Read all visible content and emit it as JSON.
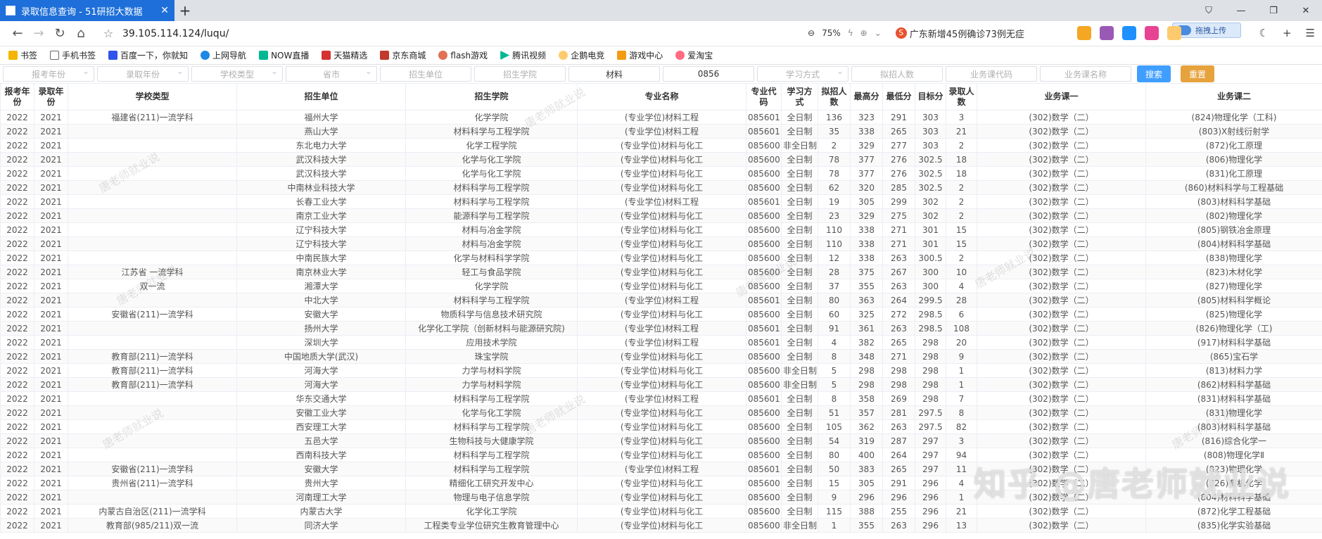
{
  "browser": {
    "tab_title": "录取信息查询 - 51研招大数据",
    "url": "39.105.114.124/luqu/",
    "zoom": "75%",
    "news_text": "广东新增45例确诊73例无症",
    "upload_label": "拖拽上传"
  },
  "bookmarks": [
    "书签",
    "手机书签",
    "百度一下，你就知",
    "上网导航",
    "NOW直播",
    "天猫精选",
    "京东商城",
    "flash游戏",
    "腾讯视频",
    "企鹅电竞",
    "游戏中心",
    "爱淘宝"
  ],
  "filters": {
    "report_year": "报考年份",
    "admit_year": "录取年份",
    "school_type": "学校类型",
    "province": "省市",
    "unit": "招生单位",
    "college": "招生学院",
    "major": "材料",
    "major_code": "0856",
    "study_mode": "学习方式",
    "plan_count": "拟招人数",
    "course_code": "业务课代码",
    "course_name": "业务课名称",
    "search": "搜索",
    "reset": "重置"
  },
  "table": {
    "headers": [
      "报考年份",
      "录取年份",
      "学校类型",
      "招生单位",
      "招生学院",
      "专业名称",
      "专业代码",
      "学习方式",
      "拟招人数",
      "最高分",
      "最低分",
      "目标分",
      "录取人数",
      "业务课一",
      "业务课二"
    ],
    "rows": [
      [
        "2022",
        "2021",
        "福建省(211)一流学科",
        "福州大学",
        "化学学院",
        "(专业学位)材料工程",
        "085601",
        "全日制",
        "136",
        "323",
        "291",
        "303",
        "3",
        "(302)数学（二）",
        "(824)物理化学（工科)"
      ],
      [
        "2022",
        "2021",
        "",
        "燕山大学",
        "材料科学与工程学院",
        "(专业学位)材料工程",
        "085601",
        "全日制",
        "35",
        "338",
        "265",
        "303",
        "21",
        "(302)数学（二）",
        "(803)X射线衍射学"
      ],
      [
        "2022",
        "2021",
        "",
        "东北电力大学",
        "化学工程学院",
        "(专业学位)材料与化工",
        "085600",
        "非全日制",
        "2",
        "329",
        "277",
        "303",
        "2",
        "(302)数学（二）",
        "(872)化工原理"
      ],
      [
        "2022",
        "2021",
        "",
        "武汉科技大学",
        "化学与化工学院",
        "(专业学位)材料与化工",
        "085600",
        "全日制",
        "78",
        "377",
        "276",
        "302.5",
        "18",
        "(302)数学（二）",
        "(806)物理化学"
      ],
      [
        "2022",
        "2021",
        "",
        "武汉科技大学",
        "化学与化工学院",
        "(专业学位)材料与化工",
        "085600",
        "全日制",
        "78",
        "377",
        "276",
        "302.5",
        "18",
        "(302)数学（二）",
        "(831)化工原理"
      ],
      [
        "2022",
        "2021",
        "",
        "中南林业科技大学",
        "材料科学与工程学院",
        "(专业学位)材料与化工",
        "085600",
        "全日制",
        "62",
        "320",
        "285",
        "302.5",
        "2",
        "(302)数学（二）",
        "(860)材料科学与工程基础"
      ],
      [
        "2022",
        "2021",
        "",
        "长春工业大学",
        "材料科学与工程学院",
        "(专业学位)材料工程",
        "085601",
        "全日制",
        "19",
        "305",
        "299",
        "302",
        "2",
        "(302)数学（二）",
        "(803)材料科学基础"
      ],
      [
        "2022",
        "2021",
        "",
        "南京工业大学",
        "能源科学与工程学院",
        "(专业学位)材料与化工",
        "085600",
        "全日制",
        "23",
        "329",
        "275",
        "302",
        "2",
        "(302)数学（二）",
        "(802)物理化学"
      ],
      [
        "2022",
        "2021",
        "",
        "辽宁科技大学",
        "材料与冶金学院",
        "(专业学位)材料与化工",
        "085600",
        "全日制",
        "110",
        "338",
        "271",
        "301",
        "15",
        "(302)数学（二）",
        "(805)钢铁冶金原理"
      ],
      [
        "2022",
        "2021",
        "",
        "辽宁科技大学",
        "材料与冶金学院",
        "(专业学位)材料与化工",
        "085600",
        "全日制",
        "110",
        "338",
        "271",
        "301",
        "15",
        "(302)数学（二）",
        "(804)材料科学基础"
      ],
      [
        "2022",
        "2021",
        "",
        "中南民族大学",
        "化学与材料科学学院",
        "(专业学位)材料与化工",
        "085600",
        "全日制",
        "12",
        "338",
        "263",
        "300.5",
        "2",
        "(302)数学（二）",
        "(838)物理化学"
      ],
      [
        "2022",
        "2021",
        "江苏省 一流学科",
        "南京林业大学",
        "轻工与食品学院",
        "(专业学位)材料与化工",
        "085600",
        "全日制",
        "28",
        "375",
        "267",
        "300",
        "10",
        "(302)数学（二）",
        "(823)木材化学"
      ],
      [
        "2022",
        "2021",
        "双一流",
        "湘潭大学",
        "化学学院",
        "(专业学位)材料与化工",
        "085600",
        "全日制",
        "37",
        "355",
        "263",
        "300",
        "4",
        "(302)数学（二）",
        "(827)物理化学"
      ],
      [
        "2022",
        "2021",
        "",
        "中北大学",
        "材料科学与工程学院",
        "(专业学位)材料工程",
        "085601",
        "全日制",
        "80",
        "363",
        "264",
        "299.5",
        "28",
        "(302)数学（二）",
        "(805)材料科学概论"
      ],
      [
        "2022",
        "2021",
        "安徽省(211)一流学科",
        "安徽大学",
        "物质科学与信息技术研究院",
        "(专业学位)材料与化工",
        "085600",
        "全日制",
        "60",
        "325",
        "272",
        "298.5",
        "6",
        "(302)数学（二）",
        "(825)物理化学"
      ],
      [
        "2022",
        "2021",
        "",
        "扬州大学",
        "化学化工学院（创新材料与能源研究院)",
        "(专业学位)材料工程",
        "085601",
        "全日制",
        "91",
        "361",
        "263",
        "298.5",
        "108",
        "(302)数学（二）",
        "(826)物理化学（工)"
      ],
      [
        "2022",
        "2021",
        "",
        "深圳大学",
        "应用技术学院",
        "(专业学位)材料工程",
        "085601",
        "全日制",
        "4",
        "382",
        "265",
        "298",
        "20",
        "(302)数学（二）",
        "(917)材料科学基础"
      ],
      [
        "2022",
        "2021",
        "教育部(211)一流学科",
        "中国地质大学(武汉)",
        "珠宝学院",
        "(专业学位)材料与化工",
        "085600",
        "全日制",
        "8",
        "348",
        "271",
        "298",
        "9",
        "(302)数学（二）",
        "(865)宝石学"
      ],
      [
        "2022",
        "2021",
        "教育部(211)一流学科",
        "河海大学",
        "力学与材料学院",
        "(专业学位)材料与化工",
        "085600",
        "非全日制",
        "5",
        "298",
        "298",
        "298",
        "1",
        "(302)数学（二）",
        "(813)材料力学"
      ],
      [
        "2022",
        "2021",
        "教育部(211)一流学科",
        "河海大学",
        "力学与材料学院",
        "(专业学位)材料与化工",
        "085600",
        "非全日制",
        "5",
        "298",
        "298",
        "298",
        "1",
        "(302)数学（二）",
        "(862)材料科学基础"
      ],
      [
        "2022",
        "2021",
        "",
        "华东交通大学",
        "材料科学与工程学院",
        "(专业学位)材料工程",
        "085601",
        "全日制",
        "8",
        "358",
        "269",
        "298",
        "7",
        "(302)数学（二）",
        "(831)材料科学基础"
      ],
      [
        "2022",
        "2021",
        "",
        "安徽工业大学",
        "化学与化工学院",
        "(专业学位)材料与化工",
        "085600",
        "全日制",
        "51",
        "357",
        "281",
        "297.5",
        "8",
        "(302)数学（二）",
        "(831)物理化学"
      ],
      [
        "2022",
        "2021",
        "",
        "西安理工大学",
        "材料科学与工程学院",
        "(专业学位)材料与化工",
        "085600",
        "全日制",
        "105",
        "362",
        "263",
        "297.5",
        "82",
        "(302)数学（二）",
        "(803)材料科学基础"
      ],
      [
        "2022",
        "2021",
        "",
        "五邑大学",
        "生物科技与大健康学院",
        "(专业学位)材料与化工",
        "085600",
        "全日制",
        "54",
        "319",
        "287",
        "297",
        "3",
        "(302)数学（二）",
        "(816)综合化学一"
      ],
      [
        "2022",
        "2021",
        "",
        "西南科技大学",
        "材料科学与工程学院",
        "(专业学位)材料与化工",
        "085600",
        "全日制",
        "80",
        "400",
        "264",
        "297",
        "94",
        "(302)数学（二）",
        "(808)物理化学Ⅱ"
      ],
      [
        "2022",
        "2021",
        "安徽省(211)一流学科",
        "安徽大学",
        "材料科学与工程学院",
        "(专业学位)材料工程",
        "085601",
        "全日制",
        "50",
        "383",
        "265",
        "297",
        "11",
        "(302)数学（二）",
        "(823)物理化学"
      ],
      [
        "2022",
        "2021",
        "贵州省(211)一流学科",
        "贵州大学",
        "精细化工研究开发中心",
        "(专业学位)材料与化工",
        "085600",
        "全日制",
        "15",
        "305",
        "291",
        "296",
        "4",
        "(302)数学（二）",
        "(826)有机化学"
      ],
      [
        "2022",
        "2021",
        "",
        "河南理工大学",
        "物理与电子信息学院",
        "(专业学位)材料与化工",
        "085600",
        "全日制",
        "9",
        "296",
        "296",
        "296",
        "1",
        "(302)数学（二）",
        "(804)材料科学基础"
      ],
      [
        "2022",
        "2021",
        "内蒙古自治区(211)一流学科",
        "内蒙古大学",
        "化学化工学院",
        "(专业学位)材料与化工",
        "085600",
        "全日制",
        "115",
        "388",
        "255",
        "296",
        "21",
        "(302)数学（二）",
        "(872)化学工程基础"
      ],
      [
        "2022",
        "2021",
        "教育部(985/211)双一流",
        "同济大学",
        "工程类专业学位研究生教育管理中心",
        "(专业学位)材料与化工",
        "085600",
        "非全日制",
        "1",
        "355",
        "263",
        "296",
        "13",
        "(302)数学（二）",
        "(835)化学实验基础"
      ]
    ]
  },
  "watermarks": [
    "唐老师就业说",
    "唐老师就业说",
    "唐老师就业说",
    "唐老师就业说",
    "唐老师就业说",
    "唐老师就业说",
    "唐老师就业说",
    "唐老师就业说"
  ],
  "zhihu_watermark": "知乎 @唐老师就业说"
}
